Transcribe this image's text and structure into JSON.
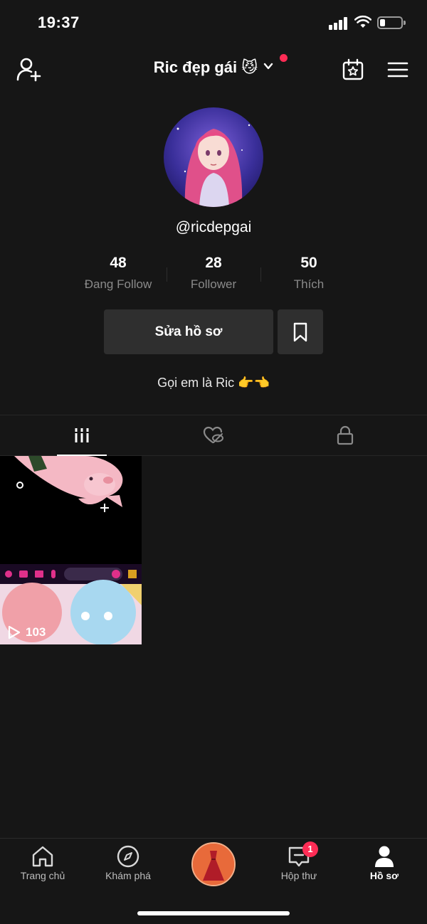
{
  "status_bar": {
    "time": "19:37"
  },
  "header": {
    "title": "Ric đẹp gái 😼",
    "icons": [
      "add-friend-icon",
      "chevron-down-icon",
      "calendar-star-icon",
      "menu-icon"
    ]
  },
  "profile": {
    "handle": "@ricdepgai",
    "bio": "Gọi em là Ric 👉👈",
    "stats": [
      {
        "value": "48",
        "label": "Đang Follow"
      },
      {
        "value": "28",
        "label": "Follower"
      },
      {
        "value": "50",
        "label": "Thích"
      }
    ],
    "edit_label": "Sửa hồ sơ"
  },
  "content_tabs": [
    {
      "name": "videos",
      "icon": "grid-icon",
      "active": true
    },
    {
      "name": "liked",
      "icon": "heart-hidden-icon",
      "active": false
    },
    {
      "name": "private",
      "icon": "lock-icon",
      "active": false
    }
  ],
  "videos": [
    {
      "views": "103"
    }
  ],
  "bottom_nav": {
    "items": [
      {
        "label": "Trang chủ",
        "icon": "home-icon"
      },
      {
        "label": "Khám phá",
        "icon": "compass-icon"
      },
      {
        "label": "",
        "icon": "create-button"
      },
      {
        "label": "Hộp thư",
        "icon": "inbox-icon",
        "badge": "1"
      },
      {
        "label": "Hồ sơ",
        "icon": "profile-icon",
        "active": true
      }
    ]
  },
  "colors": {
    "background": "#161616",
    "accent": "#fe2c55",
    "button_bg": "#2f2f2f",
    "secondary_text": "#8a8a8a"
  }
}
